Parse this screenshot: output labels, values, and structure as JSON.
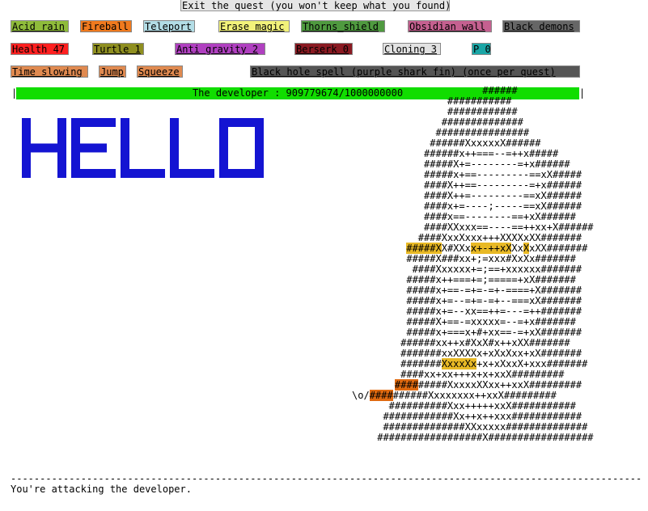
{
  "exit_button": "Exit the quest (you won't keep what you found)",
  "spells": [
    {
      "label": "Acid rain",
      "color": "#8fbc3a"
    },
    {
      "label": "Fireball",
      "color": "#f07a1e"
    },
    {
      "label": "Teleport",
      "color": "#b3dde6"
    },
    {
      "label": "Erase magic",
      "color": "#f2f27a"
    },
    {
      "label": "Thorns_shield",
      "color": "#4f9a3f"
    },
    {
      "label": "Obsidian wall",
      "color": "#c56090"
    },
    {
      "label": "Black demons",
      "color": "#666666"
    },
    {
      "label": "Health 47",
      "color": "#ff2020"
    },
    {
      "label": "Turtle 1",
      "color": "#8f8f20"
    },
    {
      "label": "Anti gravity 2",
      "color": "#b040c0"
    },
    {
      "label": "Berserk 0",
      "color": "#8a1a22"
    },
    {
      "label": "Cloning 3",
      "color": "#e2e2e2"
    },
    {
      "label": "P 0",
      "color": "#1aa6a6"
    },
    {
      "label": "Time slowing",
      "color": "#e08a50"
    },
    {
      "label": "Jump",
      "color": "#e08a50"
    },
    {
      "label": "Squeeze",
      "color": "#e08a50"
    },
    {
      "label": "Black hole spell (purple shark fin) (once per quest)",
      "color": "#555555"
    }
  ],
  "health_bar": {
    "text": "The developer : 909779674/1000000000",
    "fraction": 0.9098,
    "color": "#11dd00"
  },
  "hello_text": "HELLO",
  "hello_color": "#1414d2",
  "player": "\\o/",
  "status_message": "You're attacking the developer.",
  "separator": "----------------------------------------------------------------------------------------------------------------"
}
